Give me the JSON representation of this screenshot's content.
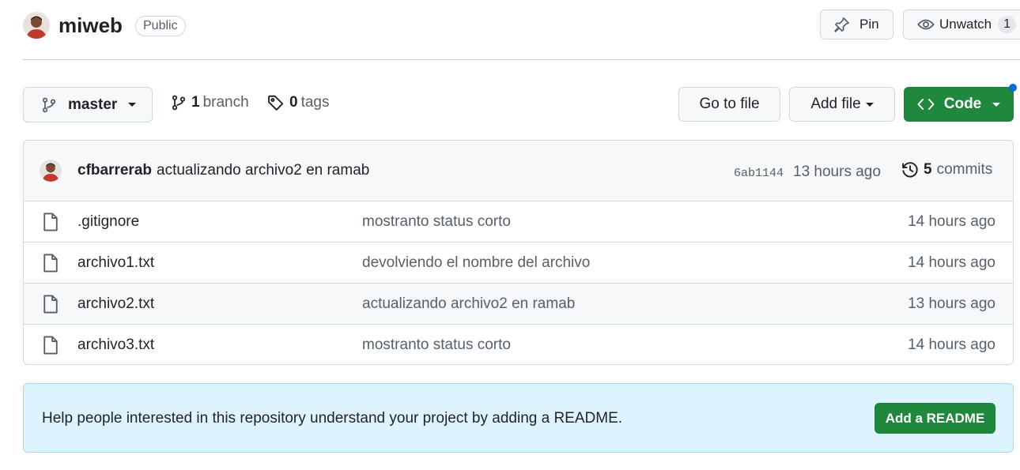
{
  "header": {
    "repo_name": "miweb",
    "visibility": "Public",
    "pin_label": "Pin",
    "watch_label": "Unwatch",
    "watch_count": "1"
  },
  "toolbar": {
    "branch_selector": "master",
    "branch_count": "1",
    "branch_label": "branch",
    "tag_count": "0",
    "tag_label": "tags",
    "go_to_file": "Go to file",
    "add_file": "Add file",
    "code": "Code"
  },
  "commit": {
    "author": "cfbarrerab",
    "message": "actualizando archivo2 en ramab",
    "sha": "6ab1144",
    "time": "13 hours ago",
    "count": "5",
    "count_label": "commits"
  },
  "files": [
    {
      "name": ".gitignore",
      "message": "mostranto status corto",
      "time": "14 hours ago"
    },
    {
      "name": "archivo1.txt",
      "message": "devolviendo el nombre del archivo",
      "time": "14 hours ago"
    },
    {
      "name": "archivo2.txt",
      "message": "actualizando archivo2 en ramab",
      "time": "13 hours ago"
    },
    {
      "name": "archivo3.txt",
      "message": "mostranto status corto",
      "time": "14 hours ago"
    }
  ],
  "readme": {
    "text": "Help people interested in this repository understand your project by adding a README.",
    "button": "Add a README"
  },
  "colors": {
    "accent_green": "#1f883d",
    "readme_bg": "#ddf4ff",
    "notification_dot": "#0969da"
  }
}
